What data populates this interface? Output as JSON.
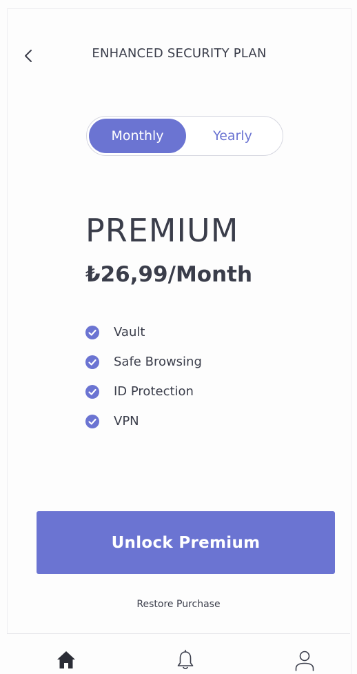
{
  "header": {
    "title": "ENHANCED SECURITY PLAN",
    "back_icon": "chevron-left-icon"
  },
  "billing_toggle": {
    "options": [
      "Monthly",
      "Yearly"
    ],
    "selected": "Monthly",
    "active_color": "#6b74d2"
  },
  "plan": {
    "name": "PREMIUM",
    "price": "₺26,99/Month",
    "features": [
      "Vault",
      "Safe Browsing",
      "ID Protection",
      "VPN"
    ],
    "feature_icon": "check-circle-icon"
  },
  "cta": {
    "label": "Unlock Premium"
  },
  "restore": {
    "label": "Restore Purchase"
  },
  "tabbar": {
    "items": [
      {
        "icon": "home-icon",
        "active": true
      },
      {
        "icon": "bell-icon",
        "active": false
      },
      {
        "icon": "user-icon",
        "active": false
      }
    ]
  },
  "colors": {
    "accent": "#6b74d2",
    "text": "#3a3d4a",
    "background": "#fdfdfd"
  }
}
